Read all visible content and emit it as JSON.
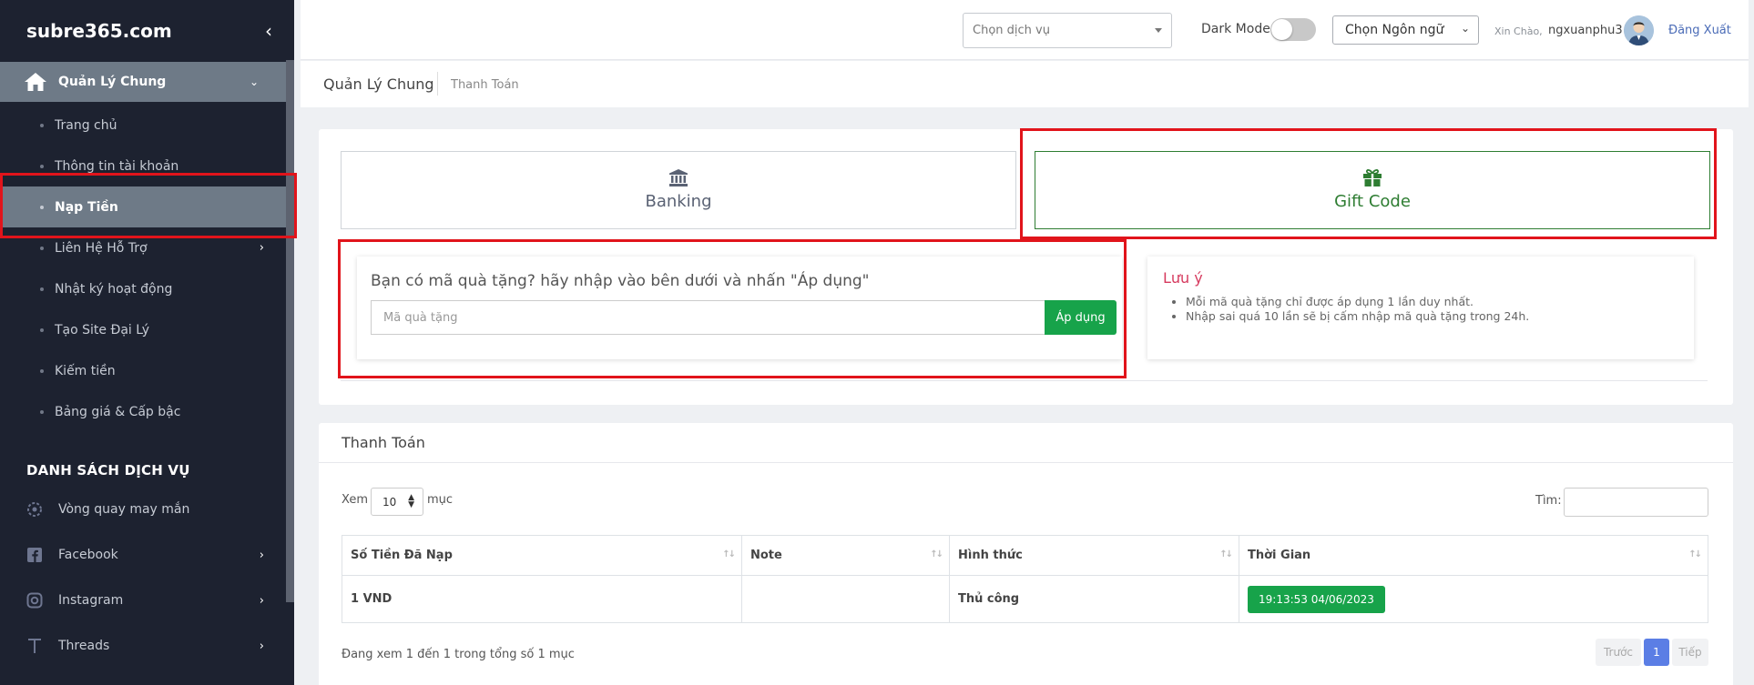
{
  "sidebar": {
    "brand": "subre365.com",
    "collapse_icon": "chevron-left-icon",
    "group": {
      "label": "Quản Lý Chung",
      "icon": "home-icon"
    },
    "items": [
      {
        "label": "Trang chủ"
      },
      {
        "label": "Thông tin tài khoản"
      },
      {
        "label": "Nạp Tiền",
        "active": true
      },
      {
        "label": "Liên Hệ Hỗ Trợ",
        "has_submenu": true
      },
      {
        "label": "Nhật ký hoạt động"
      },
      {
        "label": "Tạo Site Đại Lý"
      },
      {
        "label": "Kiếm tiền"
      },
      {
        "label": "Bảng giá & Cấp bậc"
      }
    ],
    "section_title": "DANH SÁCH DỊCH VỤ",
    "services": [
      {
        "label": "Vòng quay may mắn",
        "icon": "wheel-icon"
      },
      {
        "label": "Facebook",
        "icon": "facebook-icon",
        "has_submenu": true
      },
      {
        "label": "Instagram",
        "icon": "instagram-icon",
        "has_submenu": true
      },
      {
        "label": "Threads",
        "icon": "threads-icon",
        "has_submenu": true
      }
    ]
  },
  "topbar": {
    "service_placeholder": "Chọn dịch vụ",
    "dark_mode_label": "Dark Mode",
    "dark_mode_on": false,
    "language_placeholder": "Chọn Ngôn ngữ",
    "greeting": "Xin Chào,",
    "username": "ngxuanphu3",
    "logout": "Đăng Xuất"
  },
  "breadcrumb": {
    "main": "Quản Lý Chung",
    "sub": "Thanh Toán"
  },
  "payment": {
    "tabs": [
      {
        "label": "Banking",
        "icon": "bank-icon"
      },
      {
        "label": "Gift Code",
        "icon": "gift-icon",
        "active": true
      }
    ],
    "gift_prompt": "Bạn có mã quà tặng? hãy nhập vào bên dưới và nhấn \"Áp dụng\"",
    "gift_placeholder": "Mã quà tặng",
    "apply_label": "Áp dụng",
    "note_title": "Lưu ý",
    "notes": [
      "Mỗi mã quà tặng chỉ được áp dụng 1 lần duy nhất.",
      "Nhập sai quá 10 lần sẽ bị cấm nhập mã quà tặng trong 24h."
    ]
  },
  "history": {
    "title": "Thanh Toán",
    "show_prefix": "Xem",
    "show_value": "10",
    "show_suffix": "mục",
    "search_label": "Tìm:",
    "columns": [
      "Số Tiền Đã Nạp",
      "Note",
      "Hình thức",
      "Thời Gian"
    ],
    "rows": [
      {
        "amount": "1 VND",
        "note": "",
        "method": "Thủ công",
        "time": "19:13:53 04/06/2023"
      }
    ],
    "info": "Đang xem 1 đến 1 trong tổng số 1 mục",
    "prev": "Trước",
    "page": "1",
    "next": "Tiếp"
  },
  "colors": {
    "accent_green": "#17a34a",
    "sidebar_bg": "#1d2230",
    "highlight_red": "#e1141b",
    "pager_blue": "#5b7ee5"
  }
}
